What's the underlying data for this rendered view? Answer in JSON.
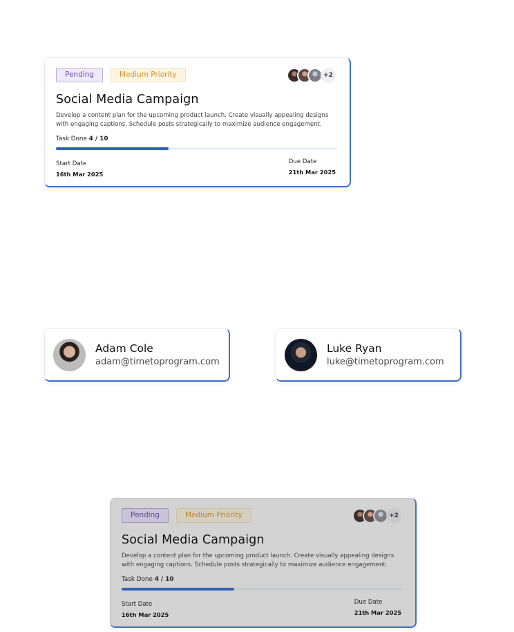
{
  "task_cards": [
    {
      "status_tag": "Pending",
      "priority_tag": "Medium Priority",
      "assignee_extra": "+2",
      "title": "Social Media Campaign",
      "description": "Develop a content plan for the upcoming product launch. Create visually appealing designs with engaging captions. Schedule posts strategically to maximize audience engagement.",
      "task_done_label": "Task Done",
      "task_done_value": "4 / 10",
      "progress_fraction": 0.4,
      "start_label": "Start Date",
      "start_value": "16th Mar 2025",
      "due_label": "Due Date",
      "due_value": "21th Mar 2025"
    },
    {
      "status_tag": "Pending",
      "priority_tag": "Medium Priority",
      "assignee_extra": "+2",
      "title": "Social Media Campaign",
      "description": "Develop a content plan for the upcoming product launch. Create visually appealing designs with engaging captions. Schedule posts strategically to maximize audience engagement.",
      "task_done_label": "Task Done",
      "task_done_value": "4 / 10",
      "progress_fraction": 0.4,
      "start_label": "Start Date",
      "start_value": "16th Mar 2025",
      "due_label": "Due Date",
      "due_value": "21th Mar 2025"
    }
  ],
  "users": [
    {
      "name": "Adam Cole",
      "email": "adam@timetoprogram.com"
    },
    {
      "name": "Luke Ryan",
      "email": "luke@timetoprogram.com"
    }
  ],
  "colors": {
    "accent_blue": "#2f64b5",
    "pending_purple": "#6d4fb3",
    "priority_orange": "#d1942d"
  }
}
